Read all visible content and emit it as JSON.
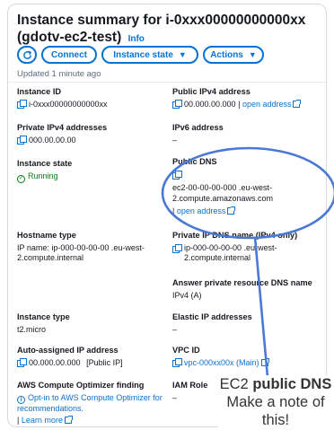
{
  "header": {
    "title": "Instance summary for i-0xxx00000000000xx (gdotv-ec2-test)",
    "info": "Info"
  },
  "toolbar": {
    "refresh_icon": "refresh-icon",
    "connect": "Connect",
    "instance_state": "Instance state",
    "actions": "Actions"
  },
  "updated": "Updated 1 minute ago",
  "left": {
    "instance_id": {
      "label": "Instance ID",
      "value": "i-0xxx00000000000xx"
    },
    "private_ipv4": {
      "label": "Private IPv4 addresses",
      "value": "000.00.00.00"
    },
    "instance_state": {
      "label": "Instance state",
      "value": "Running"
    },
    "hostname_type": {
      "label": "Hostname type",
      "value": "IP name: ip-000-00-00-00 .eu-west-2.compute.internal"
    },
    "instance_type": {
      "label": "Instance type",
      "value": "t2.micro"
    },
    "auto_ip": {
      "label": "Auto-assigned IP address",
      "value": "00.000.00.000",
      "suffix": "[Public IP]"
    },
    "optimizer": {
      "label": "AWS Compute Optimizer finding",
      "value": "Opt-in to AWS Compute Optimizer for recommendations.",
      "learn_more": "Learn more"
    }
  },
  "right": {
    "public_ipv4": {
      "label": "Public IPv4 address",
      "value": "00.000.00.000",
      "open_address": "open address"
    },
    "ipv6": {
      "label": "IPv6 address",
      "value": "–"
    },
    "public_dns": {
      "label": "Public DNS",
      "value": "ec2-00-00-00-000 .eu-west-2.compute.amazonaws.com",
      "open_address": "open address"
    },
    "private_dns": {
      "label": "Private IP DNS name (IPv4 only)",
      "value": "ip-000-00-00-00 .eu-west-2.compute.internal"
    },
    "answer_dns": {
      "label": "Answer private resource DNS name",
      "value": "IPv4 (A)"
    },
    "elastic_ip": {
      "label": "Elastic IP addresses",
      "value": "–"
    },
    "vpc_id": {
      "label": "VPC ID",
      "value": "vpc-000xx00x (Main)"
    },
    "iam_role": {
      "label": "IAM Role",
      "value": "–"
    }
  },
  "annotation": {
    "line1_prefix": "EC2 ",
    "line1_bold": "public DNS",
    "line2": "Make a note of this!",
    "color": "#4a78d6"
  }
}
